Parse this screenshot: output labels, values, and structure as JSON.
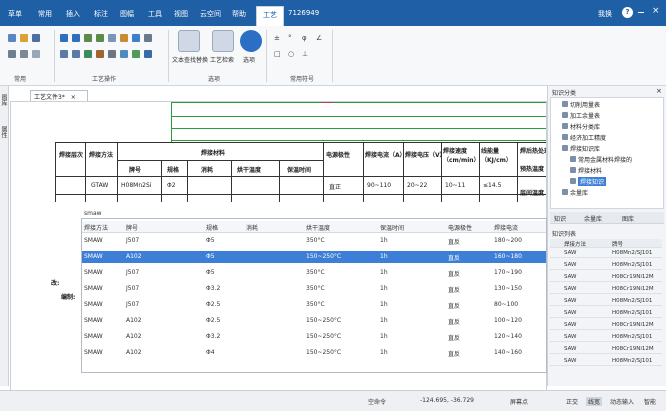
{
  "menubar": {
    "items": [
      "草单",
      "常用",
      "插入",
      "标注",
      "图幅",
      "工具",
      "视图",
      "云空间",
      "帮助",
      "工艺",
      "7126949"
    ],
    "active_index": 9,
    "user": "我换",
    "help_icon": "?"
  },
  "ribbon": {
    "groups": [
      "常用",
      "工艺操作",
      "选项",
      "常用符号"
    ],
    "big_buttons": [
      "文本查找替换",
      "工艺检索",
      "选项"
    ]
  },
  "document_tab": {
    "label": "工艺文件3*",
    "close": "×"
  },
  "leftstrip": {
    "tabs": [
      "图库",
      "属性"
    ]
  },
  "process_sheet": {
    "headers": [
      "焊接层次",
      "焊接方法",
      "焊接材料",
      "牌号",
      "规格",
      "消耗",
      "烘干温度",
      "保温时间",
      "电源极性",
      "焊接电流（A）",
      "焊接电压（V）",
      "焊接速度（cm/min）",
      "线能量（KJ/cm）",
      "焊后热处理",
      "预热温度",
      "层间温度"
    ],
    "row": {
      "method": "GTAW",
      "brand": "H08Mn2Si",
      "spec": "Φ2",
      "polarity": "直正",
      "current": "90~110",
      "voltage": "20~22",
      "speed": "10~11",
      "energy": "≤14.5"
    },
    "left_labels": [
      "改:",
      "编制:"
    ]
  },
  "popup": {
    "filter_label": "smaw",
    "columns": [
      "焊接方法",
      "牌号",
      "规格",
      "消耗",
      "烘干温度",
      "保温时间",
      "电源极性",
      "焊接电流"
    ],
    "rows": [
      [
        "SMAW",
        "J507",
        "Φ5",
        "",
        "350°C",
        "1h",
        "直反",
        "180~200"
      ],
      [
        "SMAW",
        "A102",
        "Φ5",
        "",
        "150~250°C",
        "1h",
        "直反",
        "160~180"
      ],
      [
        "SMAW",
        "J507",
        "Φ5",
        "",
        "350°C",
        "1h",
        "直反",
        "170~190"
      ],
      [
        "SMAW",
        "J507",
        "Φ3.2",
        "",
        "350°C",
        "1h",
        "直反",
        "130~150"
      ],
      [
        "SMAW",
        "J507",
        "Φ2.5",
        "",
        "350°C",
        "1h",
        "直反",
        "80~100"
      ],
      [
        "SMAW",
        "A102",
        "Φ2.5",
        "",
        "150~250°C",
        "1h",
        "直反",
        "100~120"
      ],
      [
        "SMAW",
        "A102",
        "Φ3.2",
        "",
        "150~250°C",
        "1h",
        "直反",
        "120~140"
      ],
      [
        "SMAW",
        "A102",
        "Φ4",
        "",
        "150~250°C",
        "1h",
        "直反",
        "140~160"
      ]
    ],
    "selected_index": 1
  },
  "right_panel": {
    "title": "知识分类",
    "tree": [
      "切削用量表",
      "加工余量表",
      "材料分类库",
      "经济加工精度",
      "焊接知识库",
      "常用金属材料焊接的",
      "焊接材料",
      "焊接知识",
      "余量库"
    ],
    "tabs": [
      "知识",
      "余量库",
      "图库"
    ],
    "list_title": "知识列表",
    "list_columns": [
      "焊接方法",
      "牌号"
    ],
    "list_rows": [
      [
        "SAW",
        "H08Mn2/SJ101"
      ],
      [
        "SAW",
        "H08Mn2/SJ101"
      ],
      [
        "SAW",
        "H08Cr19Ni12M"
      ],
      [
        "SAW",
        "H08Cr19Ni12M"
      ],
      [
        "SAW",
        "H08Mn2/SJ101"
      ],
      [
        "SAW",
        "H08Mn2/SJ101"
      ],
      [
        "SAW",
        "H08Cr19Ni12M"
      ],
      [
        "SAW",
        "H08Mn2/SJ101"
      ],
      [
        "SAW",
        "H08Cr19Ni12M"
      ],
      [
        "SAW",
        "H08Mn2/SJ101"
      ]
    ]
  },
  "statusbar": {
    "command": "空命令",
    "coords": "-124.695, -36.729",
    "snap": "屏幕点",
    "items": [
      "正交",
      "线宽",
      "动态输入",
      "智能"
    ]
  },
  "colors": {
    "menubar": "#1f5fa6",
    "grid": "#2a9c3a",
    "selected_row": "#3d7fd6"
  }
}
